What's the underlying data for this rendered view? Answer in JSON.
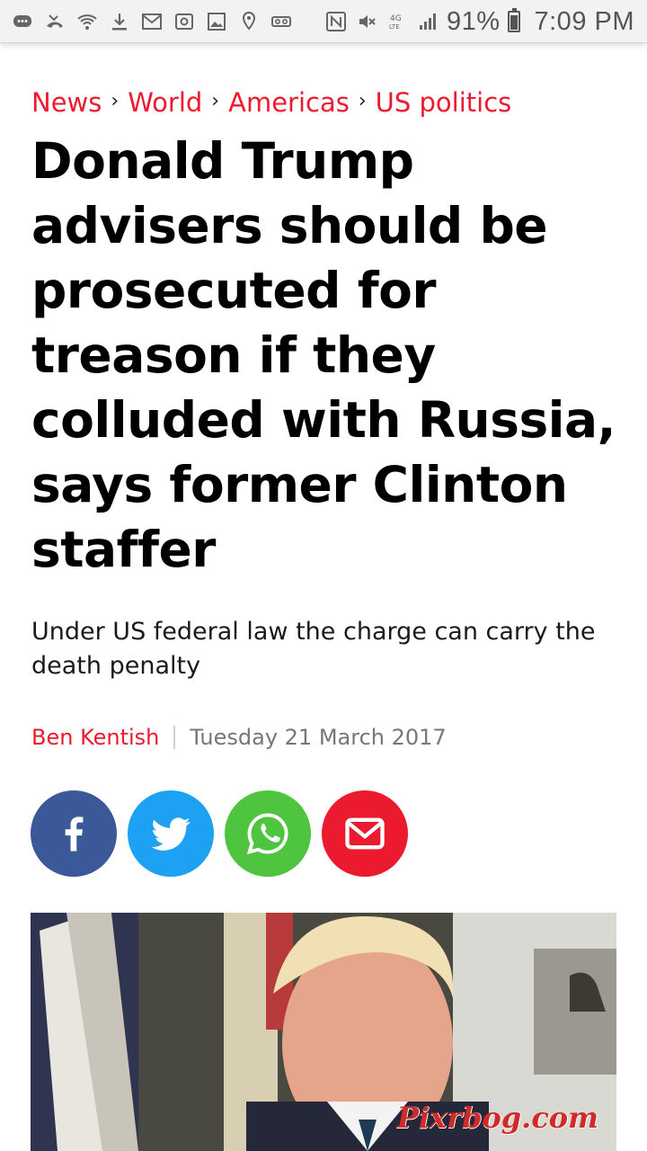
{
  "status_bar": {
    "left_icons": [
      "chat-bubble-icon",
      "missed-call-icon",
      "wifi-icon",
      "download-icon",
      "gmail-icon",
      "email-icon",
      "gallery-icon",
      "location-icon",
      "voicemail-icon"
    ],
    "right_icons": [
      "nfc-icon",
      "mute-icon",
      "lte-icon",
      "signal-icon"
    ],
    "battery_level": 0.91,
    "battery_text": "91%",
    "time": "7:09 PM"
  },
  "breadcrumb": {
    "items": [
      "News",
      "World",
      "Americas",
      "US politics"
    ],
    "separator": "›"
  },
  "article": {
    "headline": "Donald Trump advisers should be prosecuted for treason if they colluded with Russia, says former Clinton staffer",
    "standfirst": "Under US federal law the charge can carry the death penalty",
    "author": "Ben Kentish",
    "date": "Tuesday 21 March 2017"
  },
  "share": {
    "buttons": [
      {
        "name": "facebook-share-button",
        "icon": "facebook-icon",
        "color": "#3b5998"
      },
      {
        "name": "twitter-share-button",
        "icon": "twitter-icon",
        "color": "#1da1f2"
      },
      {
        "name": "whatsapp-share-button",
        "icon": "whatsapp-icon",
        "color": "#4fc43f"
      },
      {
        "name": "email-share-button",
        "icon": "mail-icon",
        "color": "#ec1a2e"
      }
    ]
  },
  "hero_image": {
    "watermark": "Pixrbog.com"
  },
  "colors": {
    "accent": "#ec1a2e",
    "text": "#000000",
    "muted": "#777777"
  }
}
